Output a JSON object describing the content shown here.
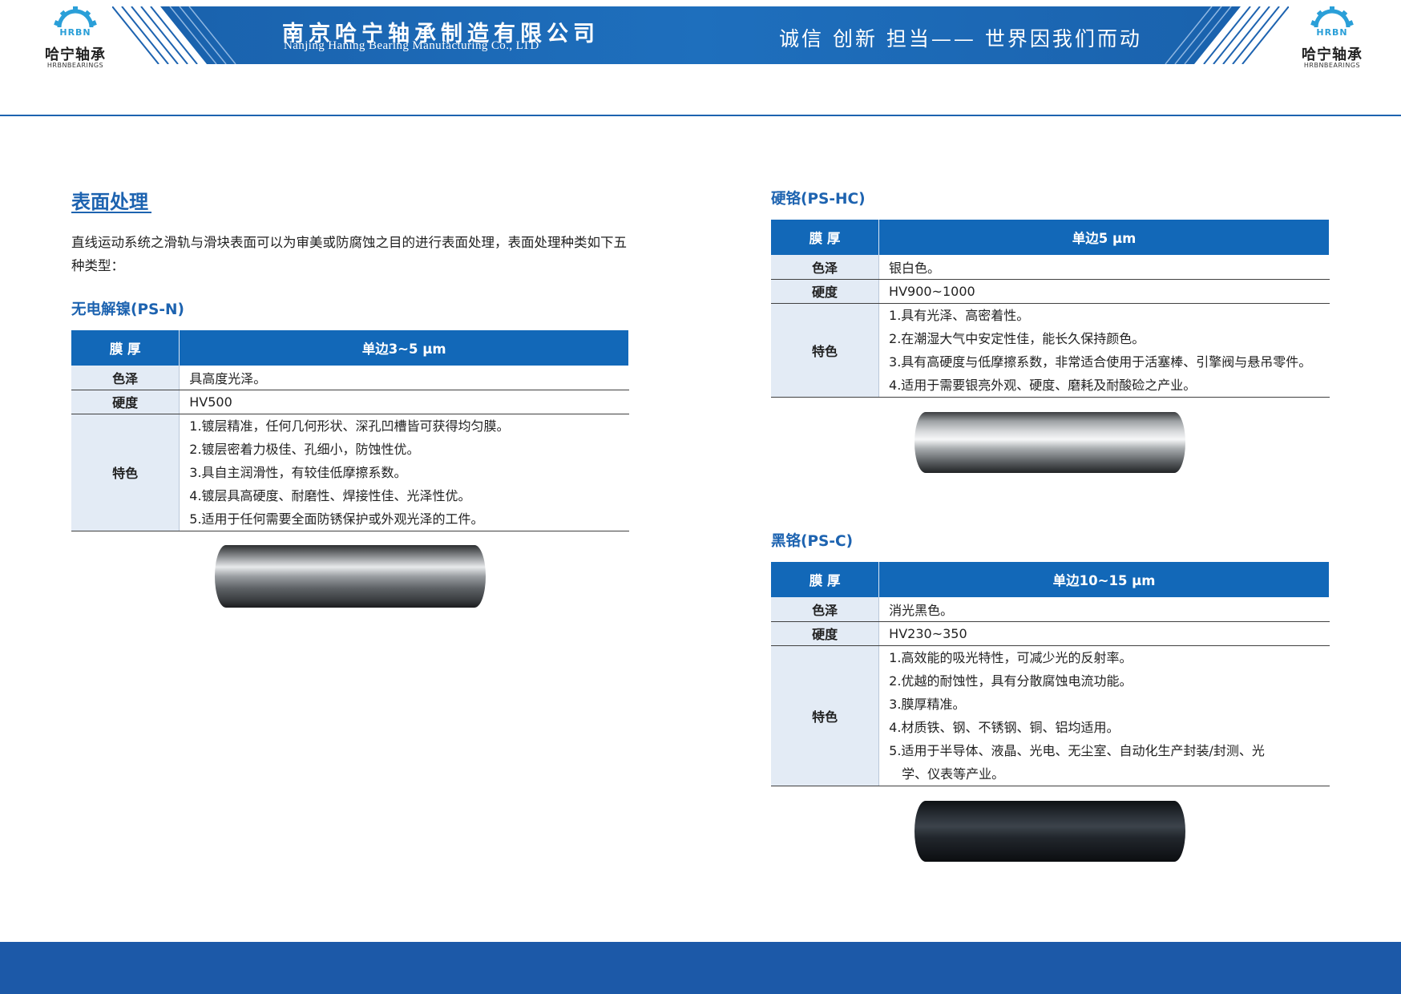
{
  "header": {
    "logo": {
      "brand": "HRBN",
      "name_cn": "哈宁轴承",
      "name_en": "HRBNBEARINGS"
    },
    "company_cn": "南京哈宁轴承制造有限公司",
    "company_en": "Nanjing Haning Bearing Manufacturing Co., LTD",
    "slogan": "诚信 创新 担当—— 世界因我们而动"
  },
  "section": {
    "title": "表面处理",
    "intro": "直线运动系统之滑轨与滑块表面可以为审美或防腐蚀之目的进行表面处理，表面处理种类如下五种类型："
  },
  "treatments": [
    {
      "title": "无电解镍(PS-N)",
      "header_label": "膜 厚",
      "thickness": "单边3~5 μm",
      "color_label": "色泽",
      "color": "具高度光泽。",
      "hardness_label": "硬度",
      "hardness": "HV500",
      "feature_label": "特色",
      "features": [
        "1.镀层精准，任何几何形状、深孔凹槽皆可获得均匀膜。",
        "2.镀层密着力极佳、孔细小，防蚀性优。",
        "3.具自主润滑性，有较佳低摩擦系数。",
        "4.镀层具高硬度、耐磨性、焊接性佳、光泽性优。",
        "5.适用于任何需要全面防锈保护或外观光泽的工件。"
      ],
      "rod_finish": "silver"
    },
    {
      "title": "硬铬(PS-HC)",
      "header_label": "膜 厚",
      "thickness": "单边5 μm",
      "color_label": "色泽",
      "color": "银白色。",
      "hardness_label": "硬度",
      "hardness": "HV900~1000",
      "feature_label": "特色",
      "features": [
        "1.具有光泽、高密着性。",
        "2.在潮湿大气中安定性佳，能长久保持颜色。",
        "3.具有高硬度与低摩擦系数，非常适合使用于活塞棒、引擎阀与悬吊零件。",
        "4.适用于需要银亮外观、硬度、磨耗及耐酸硷之产业。"
      ],
      "rod_finish": "chrome"
    },
    {
      "title": "黑铬(PS-C)",
      "header_label": "膜 厚",
      "thickness": "单边10~15 μm",
      "color_label": "色泽",
      "color": "消光黑色。",
      "hardness_label": "硬度",
      "hardness": "HV230~350",
      "feature_label": "特色",
      "features": [
        "1.高效能的吸光特性，可减少光的反射率。",
        "2.优越的耐蚀性，具有分散腐蚀电流功能。",
        "3.膜厚精准。",
        "4.材质铁、钢、不锈钢、铜、铝均适用。",
        "5.适用于半导体、液晶、光电、无尘室、自动化生产封装/封测、光",
        "学、仪表等产业。"
      ],
      "rod_finish": "black"
    }
  ],
  "colors": {
    "primary": "#1d63b0",
    "table_header": "#1268b8",
    "label_bg": "#e3ebf5",
    "footer": "#1c59a8"
  }
}
